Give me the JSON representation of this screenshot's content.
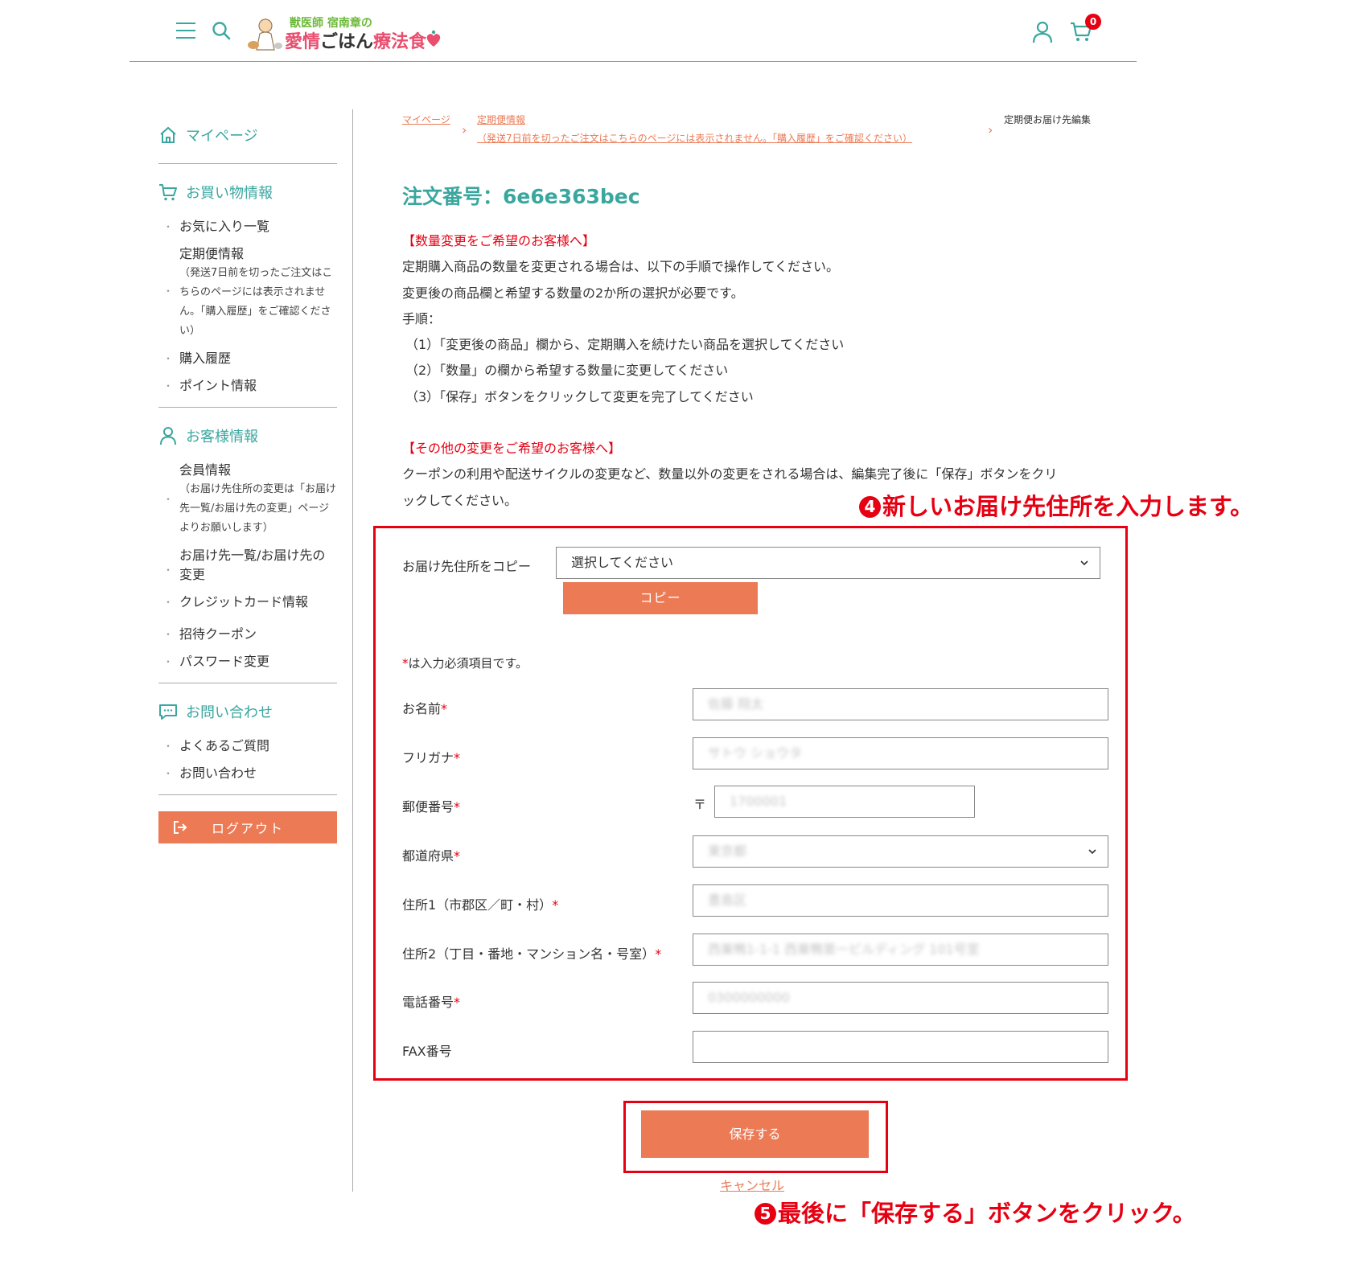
{
  "header": {
    "logo_sub": "獣医師 宿南章の",
    "logo_main_1": "愛情",
    "logo_main_2": "ごはん",
    "logo_main_3": "療法食",
    "cart_count": "0"
  },
  "sidebar": {
    "mypage": "マイページ",
    "shopping_title": "お買い物情報",
    "shopping_items": [
      "お気に入り一覧",
      "定期便情報",
      "購入履歴",
      "ポイント情報"
    ],
    "subscription_note": "（発送7日前を切ったご注文はこちらのページには表示されません。「購入履歴」をご確認ください）",
    "customer_title": "お客様情報",
    "customer_items": [
      "会員情報",
      "お届け先一覧/お届け先の変更",
      "クレジットカード情報",
      "招待クーポン",
      "パスワード変更"
    ],
    "member_note": "（お届け先住所の変更は「お届け先一覧/お届け先の変更」ページよりお願いします）",
    "contact_title": "お問い合わせ",
    "contact_items": [
      "よくあるご質問",
      "お問い合わせ"
    ],
    "logout": "ログアウト"
  },
  "breadcrumb": {
    "item1": "マイページ",
    "item2": "定期便情報",
    "item2_note": "（発送7日前を切ったご注文はこちらのページには表示されません。「購入履歴」をご確認ください）",
    "current": "定期便お届け先編集"
  },
  "main": {
    "order_title": "注文番号：6e6e363bec",
    "qty_heading": "【数量変更をご希望のお客様へ】",
    "qty_lines": [
      "定期購入商品の数量を変更される場合は、以下の手順で操作してください。",
      "変更後の商品欄と希望する数量の2か所の選択が必要です。",
      "手順：",
      "（1）「変更後の商品」欄から、定期購入を続けたい商品を選択してください",
      "（2）「数量」の欄から希望する数量に変更してください",
      "（3）「保存」ボタンをクリックして変更を完了してください"
    ],
    "other_heading": "【その他の変更をご希望のお客様へ】",
    "other_lines": [
      "クーポンの利用や配送サイクルの変更など、数量以外の変更をされる場合は、編集完了後に「保存」ボタンをクリ",
      "ックしてください。"
    ]
  },
  "annotations": {
    "step4_num": "4",
    "step4_text": "新しいお届け先住所を入力します。",
    "step5_num": "5",
    "step5_text": "最後に「保存する」ボタンをクリック。"
  },
  "form": {
    "copy_label": "お届け先住所をコピー",
    "copy_select_value": "選択してください",
    "copy_button": "コピー",
    "required_note": "は入力必須項目です。",
    "required_mark": "*",
    "name_label": "お名前",
    "name_value": "佐藤 翔太",
    "kana_label": "フリガナ",
    "kana_value": "サトウ ショウタ",
    "zip_label": "郵便番号",
    "zip_prefix": "〒",
    "zip_value": "1700001",
    "pref_label": "都道府県",
    "pref_value": "東京都",
    "addr1_label": "住所1（市郡区／町・村）",
    "addr1_value": "豊島区",
    "addr2_label": "住所2（丁目・番地・マンション名・号室）",
    "addr2_value": "西巣鴨1-1-1 西巣鴨第一ビルディング 101号室",
    "tel_label": "電話番号",
    "tel_value": "0300000000",
    "fax_label": "FAX番号",
    "fax_value": "",
    "save_button": "保存する",
    "cancel_link": "キャンセル"
  },
  "colors": {
    "accent_teal": "#3aa79f",
    "button_orange": "#ec7a55",
    "annotation_red": "#e60012"
  }
}
